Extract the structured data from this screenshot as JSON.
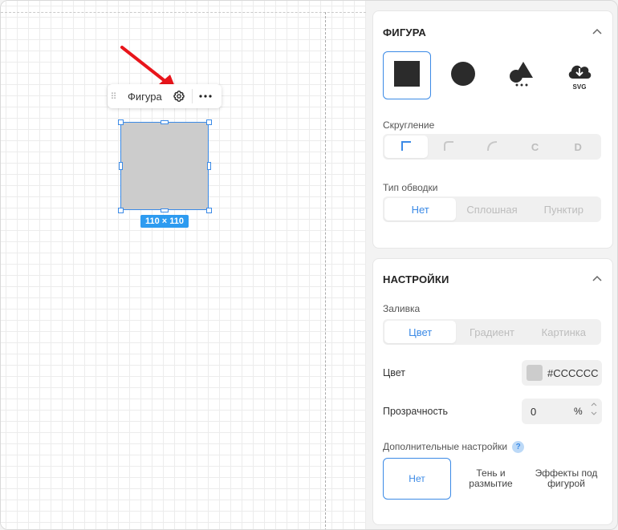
{
  "toolbar": {
    "label": "Фигура",
    "gear_icon": "gear-icon",
    "more_icon": "more-icon"
  },
  "shape": {
    "fill": "#cccccc",
    "size_label": "110 × 110"
  },
  "figure_panel": {
    "title": "ФИГУРА",
    "shape_types": [
      {
        "icon": "square-icon"
      },
      {
        "icon": "circle-icon"
      },
      {
        "icon": "shapes-more-icon"
      },
      {
        "icon": "cloud-svg-icon",
        "label": "SVG"
      }
    ],
    "rounding": {
      "label": "Скругление",
      "options": [
        "",
        "",
        "",
        "C",
        "D"
      ]
    },
    "stroke": {
      "label": "Тип обводки",
      "options": [
        "Нет",
        "Сплошная",
        "Пунктир"
      ]
    }
  },
  "settings_panel": {
    "title": "НАСТРОЙКИ",
    "fill": {
      "label": "Заливка",
      "options": [
        "Цвет",
        "Градиент",
        "Картинка"
      ]
    },
    "color": {
      "label": "Цвет",
      "value": "#CCCCCC"
    },
    "opacity": {
      "label": "Прозрачность",
      "value": "0",
      "unit": "%"
    },
    "advanced": {
      "label": "Дополнительные настройки",
      "help": "?",
      "options": [
        "Нет",
        "Тень и размытие",
        "Эффекты под фигурой"
      ]
    }
  },
  "colors": {
    "accent": "#3b8ae6",
    "badge": "#2d9bf0",
    "arrow": "#e8151b"
  }
}
